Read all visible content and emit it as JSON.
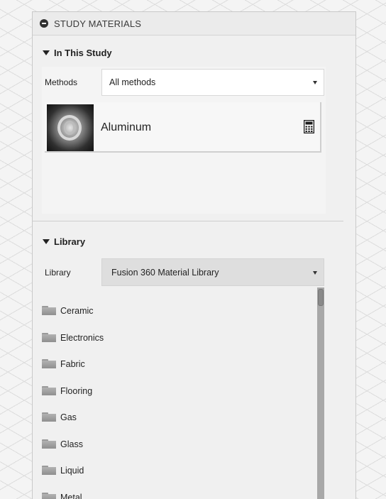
{
  "panel": {
    "title": "STUDY MATERIALS",
    "collapse_icon": "minus-circle-icon"
  },
  "in_this_study": {
    "heading": "In This Study",
    "methods_label": "Methods",
    "methods_value": "All methods",
    "materials": [
      {
        "name": "Aluminum",
        "swatch_icon": "aluminum-swatch",
        "action_icon": "calculator-icon"
      }
    ]
  },
  "library": {
    "heading": "Library",
    "library_label": "Library",
    "library_value": "Fusion 360 Material Library",
    "items": [
      {
        "label": "Ceramic"
      },
      {
        "label": "Electronics"
      },
      {
        "label": "Fabric"
      },
      {
        "label": "Flooring"
      },
      {
        "label": "Gas"
      },
      {
        "label": "Glass"
      },
      {
        "label": "Liquid"
      },
      {
        "label": "Metal"
      }
    ]
  },
  "colors": {
    "panel_bg": "#f0f0f0",
    "select_bg": "#ffffff",
    "library_select_bg": "#dedede",
    "folder": "#9a9a9a",
    "text": "#222222"
  }
}
